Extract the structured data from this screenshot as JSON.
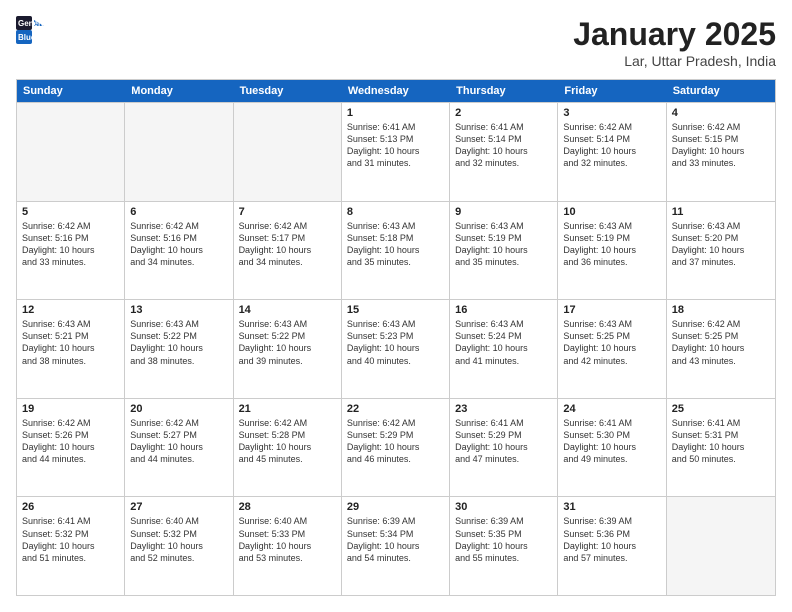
{
  "logo": {
    "text_general": "General",
    "text_blue": "Blue"
  },
  "header": {
    "month": "January 2025",
    "location": "Lar, Uttar Pradesh, India"
  },
  "days_of_week": [
    "Sunday",
    "Monday",
    "Tuesday",
    "Wednesday",
    "Thursday",
    "Friday",
    "Saturday"
  ],
  "weeks": [
    [
      {
        "day": "",
        "info": "",
        "empty": true
      },
      {
        "day": "",
        "info": "",
        "empty": true
      },
      {
        "day": "",
        "info": "",
        "empty": true
      },
      {
        "day": "1",
        "info": "Sunrise: 6:41 AM\nSunset: 5:13 PM\nDaylight: 10 hours\nand 31 minutes.",
        "empty": false
      },
      {
        "day": "2",
        "info": "Sunrise: 6:41 AM\nSunset: 5:14 PM\nDaylight: 10 hours\nand 32 minutes.",
        "empty": false
      },
      {
        "day": "3",
        "info": "Sunrise: 6:42 AM\nSunset: 5:14 PM\nDaylight: 10 hours\nand 32 minutes.",
        "empty": false
      },
      {
        "day": "4",
        "info": "Sunrise: 6:42 AM\nSunset: 5:15 PM\nDaylight: 10 hours\nand 33 minutes.",
        "empty": false
      }
    ],
    [
      {
        "day": "5",
        "info": "Sunrise: 6:42 AM\nSunset: 5:16 PM\nDaylight: 10 hours\nand 33 minutes.",
        "empty": false
      },
      {
        "day": "6",
        "info": "Sunrise: 6:42 AM\nSunset: 5:16 PM\nDaylight: 10 hours\nand 34 minutes.",
        "empty": false
      },
      {
        "day": "7",
        "info": "Sunrise: 6:42 AM\nSunset: 5:17 PM\nDaylight: 10 hours\nand 34 minutes.",
        "empty": false
      },
      {
        "day": "8",
        "info": "Sunrise: 6:43 AM\nSunset: 5:18 PM\nDaylight: 10 hours\nand 35 minutes.",
        "empty": false
      },
      {
        "day": "9",
        "info": "Sunrise: 6:43 AM\nSunset: 5:19 PM\nDaylight: 10 hours\nand 35 minutes.",
        "empty": false
      },
      {
        "day": "10",
        "info": "Sunrise: 6:43 AM\nSunset: 5:19 PM\nDaylight: 10 hours\nand 36 minutes.",
        "empty": false
      },
      {
        "day": "11",
        "info": "Sunrise: 6:43 AM\nSunset: 5:20 PM\nDaylight: 10 hours\nand 37 minutes.",
        "empty": false
      }
    ],
    [
      {
        "day": "12",
        "info": "Sunrise: 6:43 AM\nSunset: 5:21 PM\nDaylight: 10 hours\nand 38 minutes.",
        "empty": false
      },
      {
        "day": "13",
        "info": "Sunrise: 6:43 AM\nSunset: 5:22 PM\nDaylight: 10 hours\nand 38 minutes.",
        "empty": false
      },
      {
        "day": "14",
        "info": "Sunrise: 6:43 AM\nSunset: 5:22 PM\nDaylight: 10 hours\nand 39 minutes.",
        "empty": false
      },
      {
        "day": "15",
        "info": "Sunrise: 6:43 AM\nSunset: 5:23 PM\nDaylight: 10 hours\nand 40 minutes.",
        "empty": false
      },
      {
        "day": "16",
        "info": "Sunrise: 6:43 AM\nSunset: 5:24 PM\nDaylight: 10 hours\nand 41 minutes.",
        "empty": false
      },
      {
        "day": "17",
        "info": "Sunrise: 6:43 AM\nSunset: 5:25 PM\nDaylight: 10 hours\nand 42 minutes.",
        "empty": false
      },
      {
        "day": "18",
        "info": "Sunrise: 6:42 AM\nSunset: 5:25 PM\nDaylight: 10 hours\nand 43 minutes.",
        "empty": false
      }
    ],
    [
      {
        "day": "19",
        "info": "Sunrise: 6:42 AM\nSunset: 5:26 PM\nDaylight: 10 hours\nand 44 minutes.",
        "empty": false
      },
      {
        "day": "20",
        "info": "Sunrise: 6:42 AM\nSunset: 5:27 PM\nDaylight: 10 hours\nand 44 minutes.",
        "empty": false
      },
      {
        "day": "21",
        "info": "Sunrise: 6:42 AM\nSunset: 5:28 PM\nDaylight: 10 hours\nand 45 minutes.",
        "empty": false
      },
      {
        "day": "22",
        "info": "Sunrise: 6:42 AM\nSunset: 5:29 PM\nDaylight: 10 hours\nand 46 minutes.",
        "empty": false
      },
      {
        "day": "23",
        "info": "Sunrise: 6:41 AM\nSunset: 5:29 PM\nDaylight: 10 hours\nand 47 minutes.",
        "empty": false
      },
      {
        "day": "24",
        "info": "Sunrise: 6:41 AM\nSunset: 5:30 PM\nDaylight: 10 hours\nand 49 minutes.",
        "empty": false
      },
      {
        "day": "25",
        "info": "Sunrise: 6:41 AM\nSunset: 5:31 PM\nDaylight: 10 hours\nand 50 minutes.",
        "empty": false
      }
    ],
    [
      {
        "day": "26",
        "info": "Sunrise: 6:41 AM\nSunset: 5:32 PM\nDaylight: 10 hours\nand 51 minutes.",
        "empty": false
      },
      {
        "day": "27",
        "info": "Sunrise: 6:40 AM\nSunset: 5:32 PM\nDaylight: 10 hours\nand 52 minutes.",
        "empty": false
      },
      {
        "day": "28",
        "info": "Sunrise: 6:40 AM\nSunset: 5:33 PM\nDaylight: 10 hours\nand 53 minutes.",
        "empty": false
      },
      {
        "day": "29",
        "info": "Sunrise: 6:39 AM\nSunset: 5:34 PM\nDaylight: 10 hours\nand 54 minutes.",
        "empty": false
      },
      {
        "day": "30",
        "info": "Sunrise: 6:39 AM\nSunset: 5:35 PM\nDaylight: 10 hours\nand 55 minutes.",
        "empty": false
      },
      {
        "day": "31",
        "info": "Sunrise: 6:39 AM\nSunset: 5:36 PM\nDaylight: 10 hours\nand 57 minutes.",
        "empty": false
      },
      {
        "day": "",
        "info": "",
        "empty": true
      }
    ]
  ]
}
